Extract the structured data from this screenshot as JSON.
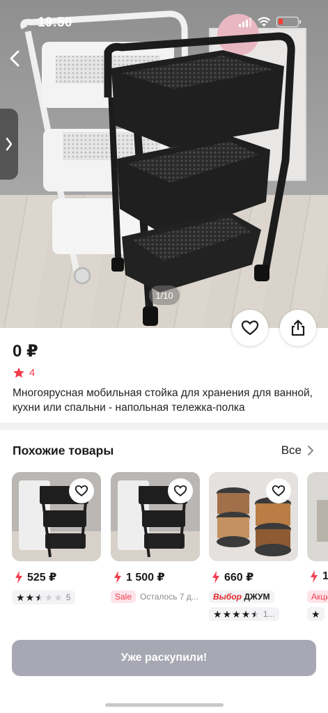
{
  "status_bar": {
    "time": "19:50"
  },
  "hero": {
    "counter": "1/10",
    "icons": {
      "back": "chevron-left-icon",
      "favorite": "heart-icon",
      "share": "share-icon",
      "gallery_tab": "chevron-right-icon"
    }
  },
  "product": {
    "price": "0 ₽",
    "rating": "4",
    "title": "Многоярусная мобильная стойка для хранения для ванной, кухни или спальни - напольная тележка-полка"
  },
  "similar": {
    "title": "Похожие товары",
    "all_label": "Все",
    "cards": [
      {
        "price": "525 ₽",
        "stars": 2.5,
        "reviews": "5"
      },
      {
        "price": "1 500 ₽",
        "sale_label": "Sale",
        "stock_text": "Осталось 7 д..."
      },
      {
        "price": "660 ₽",
        "brand_prefix": "Выбор",
        "brand_name": "ДЖУМ",
        "stars": 4.5,
        "reviews": "1..."
      },
      {
        "price": "1",
        "tag": "Акци"
      }
    ]
  },
  "cta": {
    "label": "Уже раскупили!"
  },
  "colors": {
    "accent": "#f23d4f",
    "button_disabled": "#a7a8b3",
    "divider": "#f2f2f4"
  }
}
